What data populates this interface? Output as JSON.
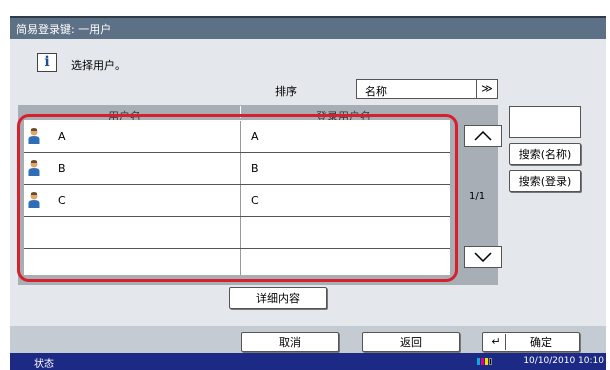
{
  "title": "简易登录键:  一用户",
  "message": "选择用户。",
  "sort": {
    "label": "排序",
    "value": "名称",
    "arrow": "≫"
  },
  "columns": {
    "name": "用户名",
    "login": "登录用户名"
  },
  "rows": [
    {
      "name": "A",
      "login": "A"
    },
    {
      "name": "B",
      "login": "B"
    },
    {
      "name": "C",
      "login": "C"
    }
  ],
  "page_indicator": "1/1",
  "buttons": {
    "search_name": "搜索(名称)",
    "search_login": "搜索(登录)",
    "detail": "详细内容",
    "cancel": "取消",
    "back": "返回",
    "ok": "确定"
  },
  "status": {
    "label": "状态",
    "datetime": "10/10/2010  10:10"
  },
  "colors": {
    "highlight": "#d81f2c",
    "titlebar": "#5d7186",
    "statusbar": "#1c2a86"
  }
}
